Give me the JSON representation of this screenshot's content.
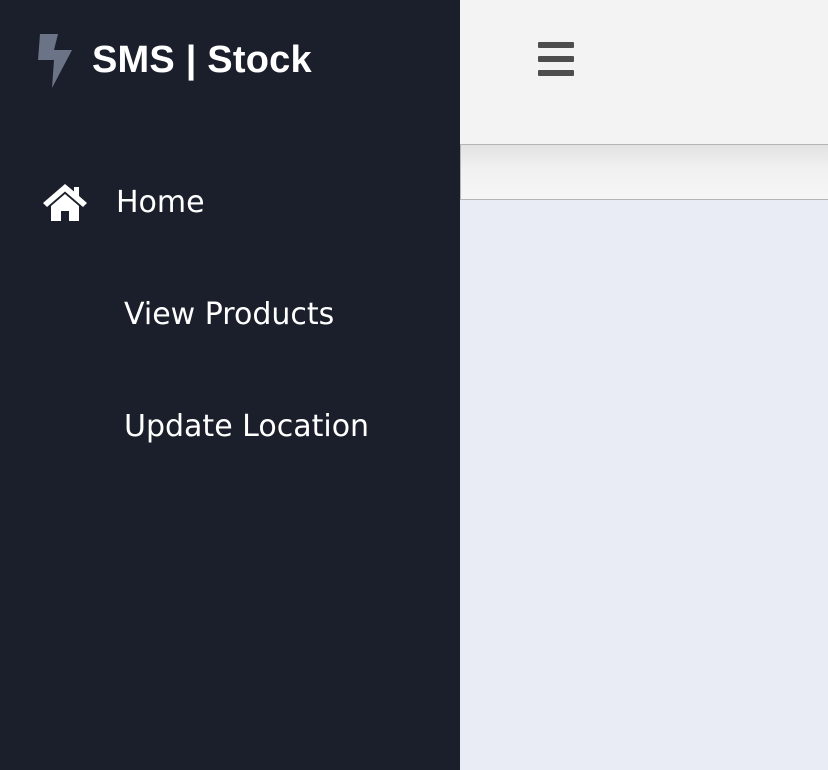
{
  "brand": {
    "title": "SMS | Stock",
    "icon": "lightning-bolt-icon"
  },
  "sidebar": {
    "items": [
      {
        "label": "Home",
        "icon": "home-icon"
      },
      {
        "label": "View Products"
      },
      {
        "label": "Update Location"
      }
    ]
  },
  "topbar": {
    "menu_icon": "hamburger-menu-icon"
  },
  "colors": {
    "sidebar_bg": "#1b1f2b",
    "topbar_bg": "#f3f3f3",
    "content_bg": "#e9ecf5",
    "brand_icon": "#6b7386",
    "text": "#ffffff"
  }
}
